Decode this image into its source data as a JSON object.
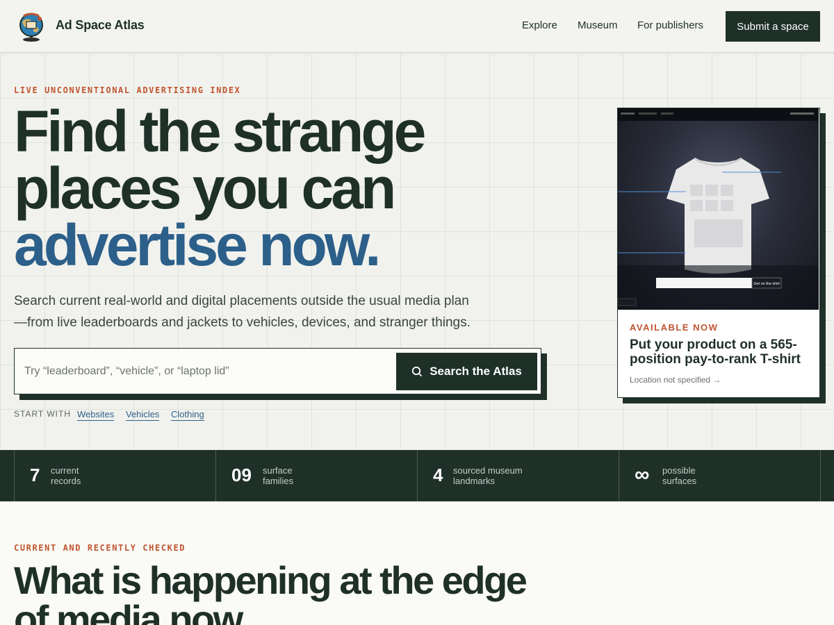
{
  "header": {
    "brand": "Ad Space Atlas",
    "nav": [
      "Explore",
      "Museum",
      "For publishers"
    ],
    "cta": "Submit a space"
  },
  "hero": {
    "eyebrow": "LIVE UNCONVENTIONAL ADVERTISING INDEX",
    "headline_line1": "Find the strange",
    "headline_line2": "places you can",
    "headline_line3": "advertise now.",
    "subhead_line1": "Search current real-world and digital placements outside the usual media plan",
    "subhead_line2": "—from live leaderboards and jackets to vehicles, devices, and stranger things.",
    "search_placeholder": "Try “leaderboard”, “vehicle”, or “laptop lid”",
    "search_button": "Search the Atlas",
    "start_with_label": "START WITH",
    "quick_links": [
      "Websites",
      "Vehicles",
      "Clothing"
    ]
  },
  "card": {
    "eyebrow": "AVAILABLE NOW",
    "title": "Put your product on a 565-position pay-to-rank T-shirt",
    "location": "Location not specified →",
    "image_cta": "Get on the shirt"
  },
  "stats": [
    {
      "number": "7",
      "label_line1": "current",
      "label_line2": "records"
    },
    {
      "number": "09",
      "label_line1": "surface",
      "label_line2": "families"
    },
    {
      "number": "4",
      "label_line1": "sourced museum",
      "label_line2": "landmarks"
    },
    {
      "number": "∞",
      "label_line1": "possible",
      "label_line2": "surfaces"
    }
  ],
  "section": {
    "eyebrow": "CURRENT AND RECENTLY CHECKED",
    "title": "What is happening at the edge of media now."
  },
  "colors": {
    "dark": "#1f3029",
    "accent_orange": "#c0552f",
    "accent_blue": "#2c5f8a",
    "background": "#f3f4ef"
  }
}
